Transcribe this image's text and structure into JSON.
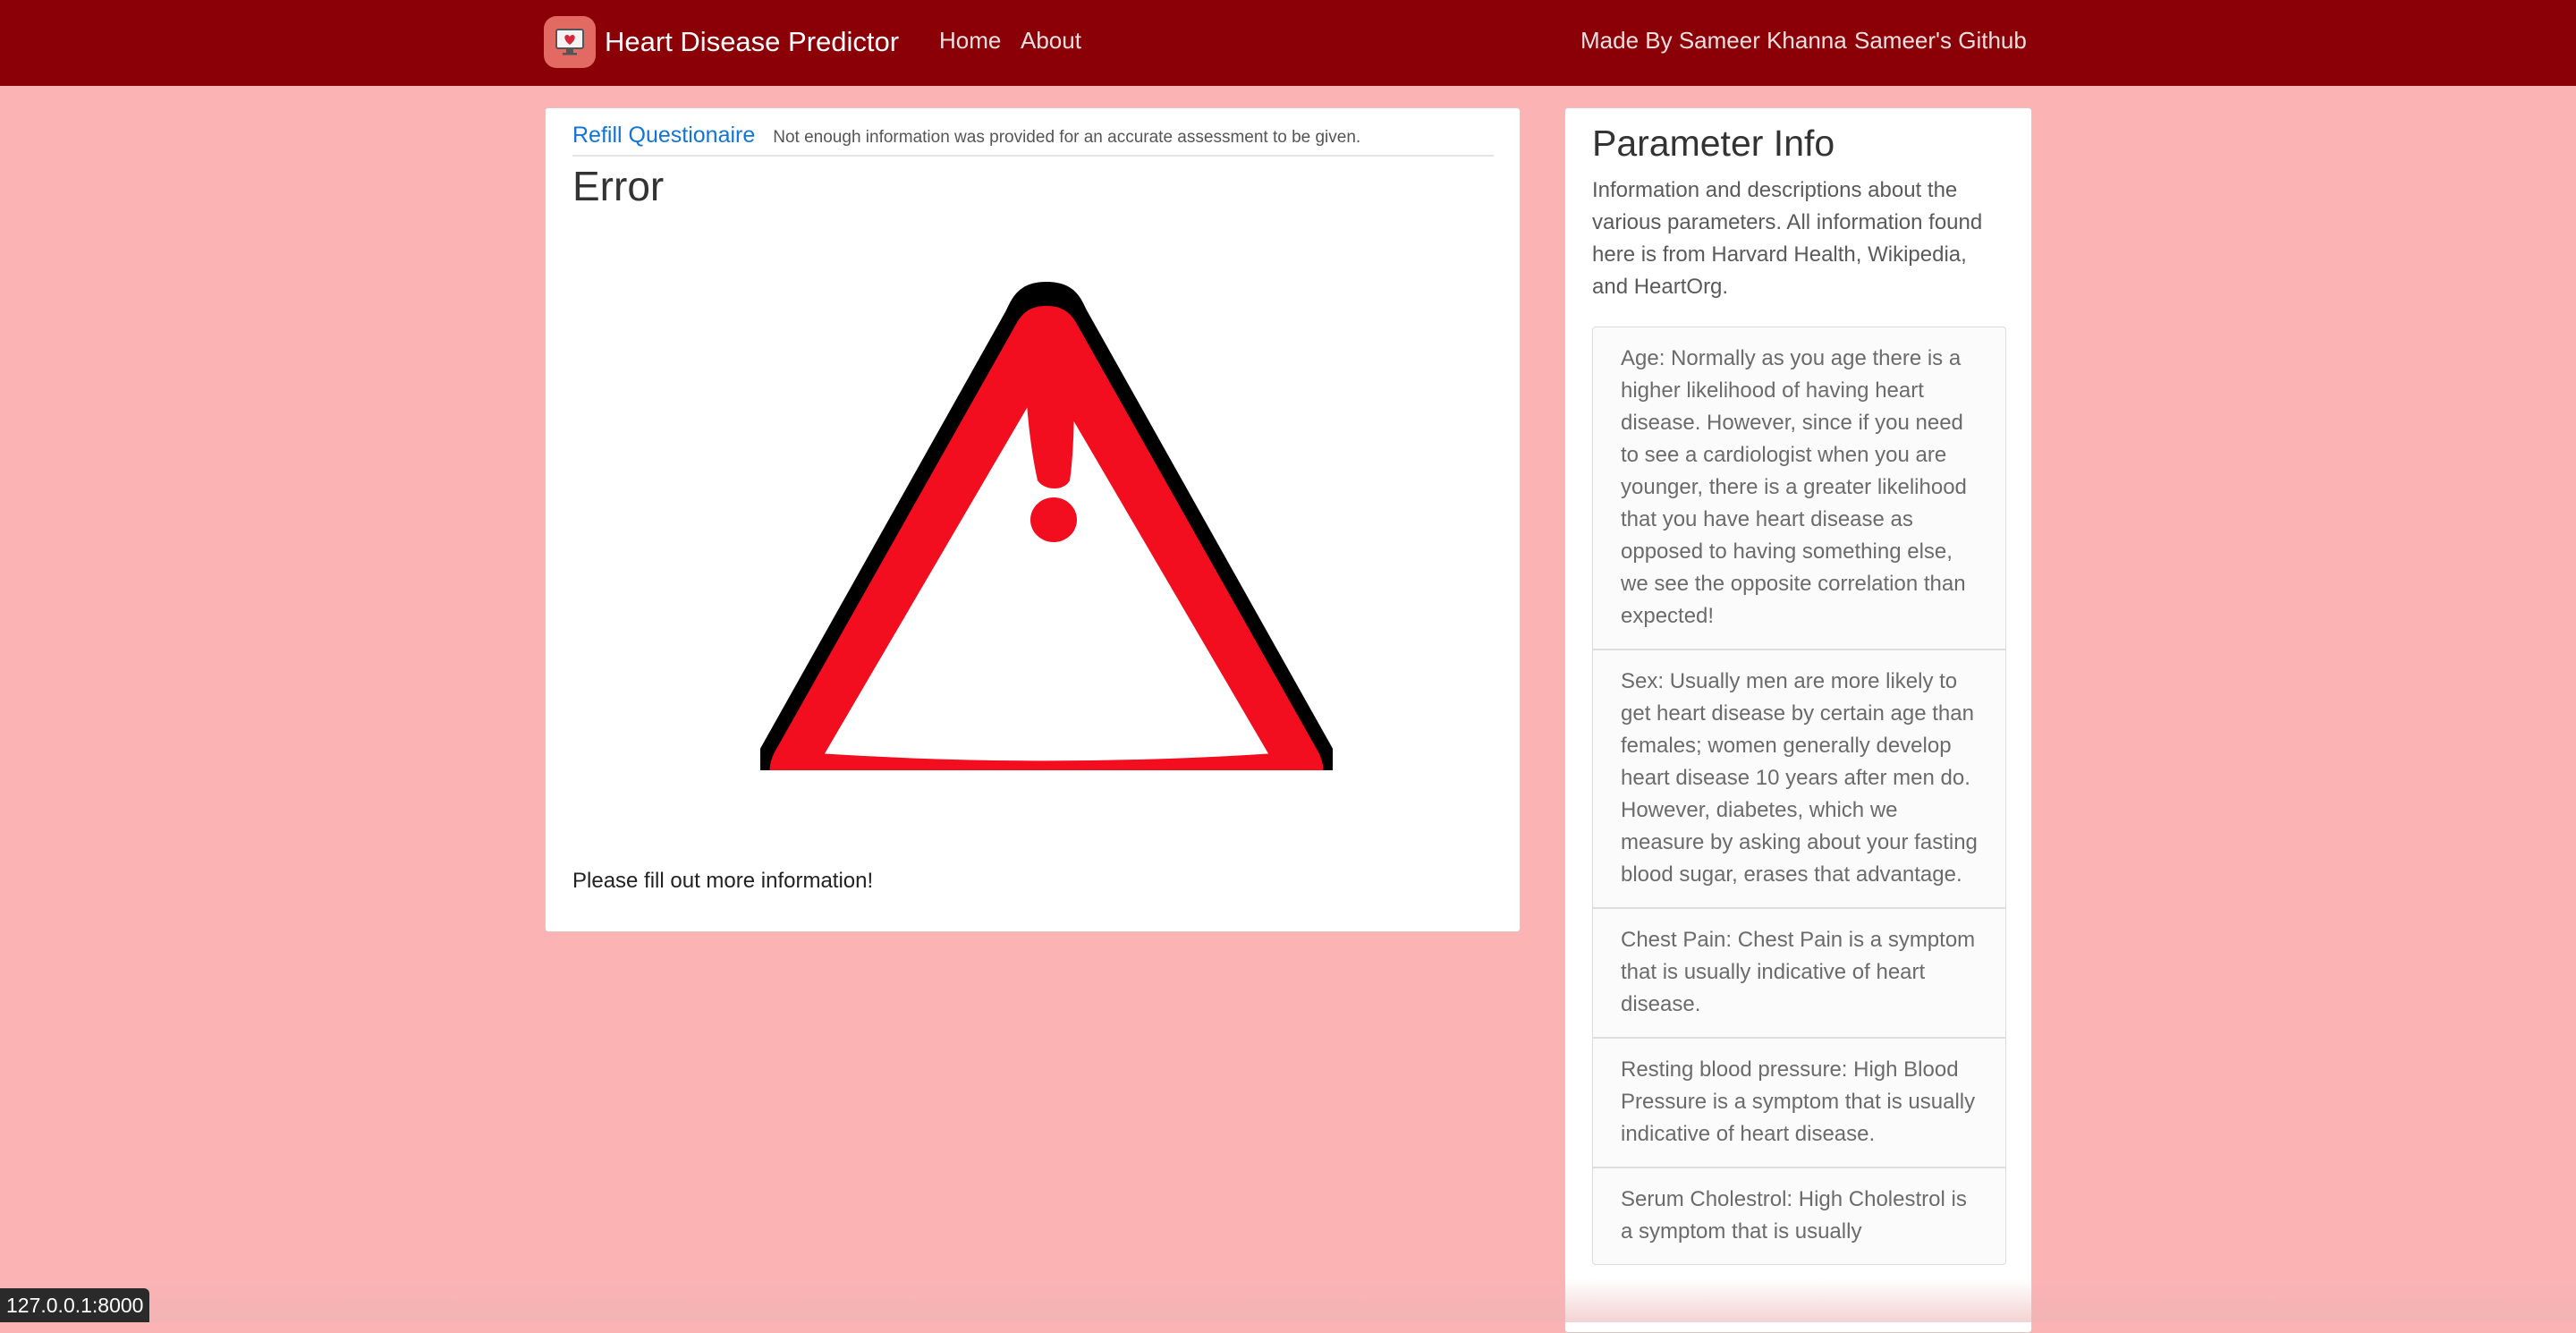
{
  "navbar": {
    "brand_title": "Heart Disease Predictor",
    "brand_icon": "monitor-heart-icon",
    "links": {
      "home": "Home",
      "about": "About",
      "made_by": "Made By Sameer Khanna",
      "github": "Sameer's Github"
    }
  },
  "main": {
    "refill_link": "Refill Questionaire",
    "refill_note": "Not enough information was provided for an accurate assessment to be given.",
    "title": "Error",
    "warning_icon": "warning-triangle-icon",
    "message": "Please fill out more information!"
  },
  "sidebar": {
    "title": "Parameter Info",
    "description": "Information and descriptions about the various parameters. All information found here is from Harvard Health, Wikipedia, and HeartOrg.",
    "items": [
      {
        "text": "Age: Normally as you age there is a higher likelihood of having heart disease. However, since if you need to see a cardiologist when you are younger, there is a greater likelihood that you have heart disease as opposed to having something else, we see the opposite correlation than expected!"
      },
      {
        "text": "Sex: Usually men are more likely to get heart disease by certain age than females; women generally develop heart disease 10 years after men do. However, diabetes, which we measure by asking about your fasting blood sugar, erases that advantage."
      },
      {
        "text": "Chest Pain: Chest Pain is a symptom that is usually indicative of heart disease."
      },
      {
        "text": "Resting blood pressure: High Blood Pressure is a symptom that is usually indicative of heart disease."
      },
      {
        "text": "Serum Cholestrol: High Cholestrol is a symptom that is usually"
      }
    ]
  },
  "status_bar": {
    "url": "127.0.0.1:8000"
  },
  "colors": {
    "navbar": "#8b0007",
    "background": "#fcb3b4",
    "link": "#1474d4",
    "warning_red": "#f20d1f"
  }
}
